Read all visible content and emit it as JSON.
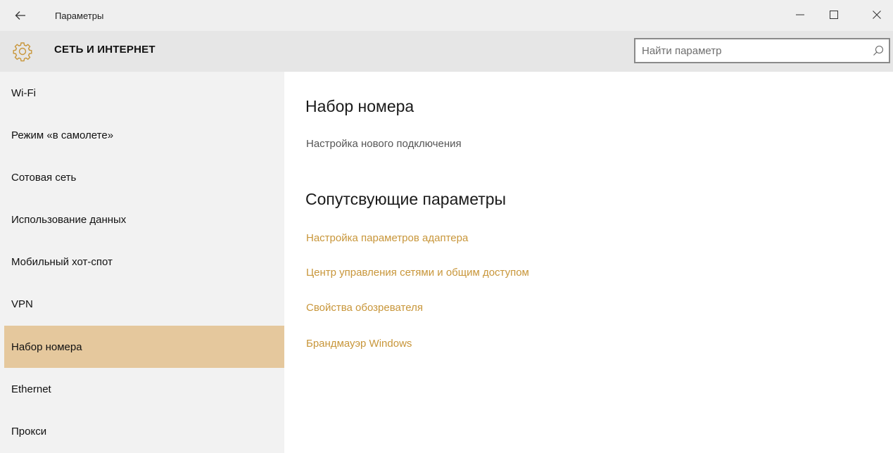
{
  "window": {
    "title": "Параметры",
    "back_icon": "arrow-left-icon",
    "controls": [
      "minimize-icon",
      "maximize-icon",
      "close-icon"
    ]
  },
  "header": {
    "icon": "gear-icon",
    "title": "СЕТЬ И ИНТЕРНЕТ",
    "search_placeholder": "Найти параметр",
    "search_icon": "search-icon"
  },
  "accent_color": "#e5c89d",
  "link_color": "#c8963a",
  "sidebar": {
    "items": [
      {
        "label": "Wi-Fi",
        "selected": false
      },
      {
        "label": "Режим «в самолете»",
        "selected": false
      },
      {
        "label": "Сотовая сеть",
        "selected": false
      },
      {
        "label": "Использование данных",
        "selected": false
      },
      {
        "label": "Мобильный хот-спот",
        "selected": false
      },
      {
        "label": "VPN",
        "selected": false
      },
      {
        "label": "Набор номера",
        "selected": true
      },
      {
        "label": "Ethernet",
        "selected": false
      },
      {
        "label": "Прокси",
        "selected": false
      }
    ]
  },
  "main": {
    "heading": "Набор номера",
    "setup_link": "Настройка нового подключения",
    "related_heading": "Сопутсвующие параметры",
    "related_links": [
      "Настройка параметров адаптера",
      "Центр управления сетями и общим доступом",
      "Свойства обозревателя",
      "Брандмауэр Windows"
    ]
  }
}
